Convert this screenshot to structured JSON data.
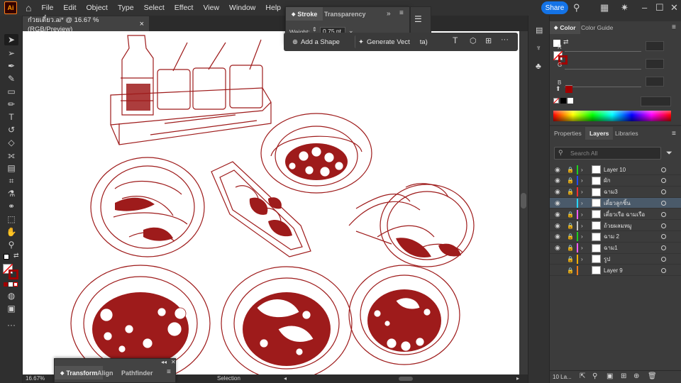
{
  "app": {
    "logo": "Ai",
    "menus": [
      "File",
      "Edit",
      "Object",
      "Type",
      "Select",
      "Effect",
      "View",
      "Window",
      "Help"
    ],
    "share_label": "Share",
    "icons": [
      "home-icon",
      "search-icon",
      "arrange-documents-icon",
      "discover-icon",
      "minimize-icon",
      "maximize-icon",
      "close-icon"
    ]
  },
  "document": {
    "tab_title": "ก๋วยเตี๋ยว.ai* @ 16.67 % (RGB/Preview)",
    "close_glyph": "×",
    "zoom": "16.67%",
    "status_tool": "Selection"
  },
  "stroke_panel": {
    "tabs": [
      "Stroke",
      "Transparency"
    ],
    "weight_label": "Weight:",
    "weight_value": "0.75 pt"
  },
  "context_bar": {
    "add_shape_label": "Add a Shape",
    "generate_label": "Generate Vect",
    "beta_label": "ta)"
  },
  "color_panel": {
    "tabs": [
      "Color",
      "Color Guide"
    ],
    "channels": [
      "R",
      "G",
      "B"
    ],
    "swatch_color": "#a00000"
  },
  "layers_panel": {
    "tabs": [
      "Properties",
      "Layers",
      "Libraries"
    ],
    "search_placeholder": "Search All",
    "layers": [
      {
        "name": "Layer 10",
        "color": "#1fd11f",
        "expandable": true,
        "visible": true,
        "locked": true,
        "selected": false
      },
      {
        "name": "ผัก",
        "color": "#1f4bff",
        "expandable": true,
        "visible": true,
        "locked": true,
        "selected": false
      },
      {
        "name": "ฉาม3",
        "color": "#ff2d2d",
        "expandable": true,
        "visible": true,
        "locked": true,
        "selected": false
      },
      {
        "name": "เตี๋ยวลูกชิ้น",
        "color": "#27d7ff",
        "expandable": true,
        "visible": true,
        "locked": false,
        "selected": true
      },
      {
        "name": "เตี๋ยวเรือ ฉามเรือ",
        "color": "#ff5cff",
        "expandable": true,
        "visible": true,
        "locked": true,
        "selected": false
      },
      {
        "name": "ถ้วยผลมหมู",
        "color": "#c8c8c8",
        "expandable": true,
        "visible": true,
        "locked": true,
        "selected": false
      },
      {
        "name": "ฉาม 2",
        "color": "#1fd11f",
        "expandable": true,
        "visible": true,
        "locked": true,
        "selected": false
      },
      {
        "name": "ฉาม1",
        "color": "#ff5cff",
        "expandable": true,
        "visible": true,
        "locked": true,
        "selected": false
      },
      {
        "name": "รูป",
        "color": "#ffb000",
        "expandable": true,
        "visible": false,
        "locked": true,
        "selected": false
      },
      {
        "name": "Layer 9",
        "color": "#ff7f18",
        "expandable": false,
        "visible": false,
        "locked": true,
        "selected": false
      }
    ],
    "footer_count": "10 La..."
  },
  "transform_panel": {
    "tabs": [
      "Transform",
      "Align",
      "Pathfinder"
    ]
  },
  "colors": {
    "art_red": "#9e1b1b",
    "accent_blue": "#1473e6"
  }
}
